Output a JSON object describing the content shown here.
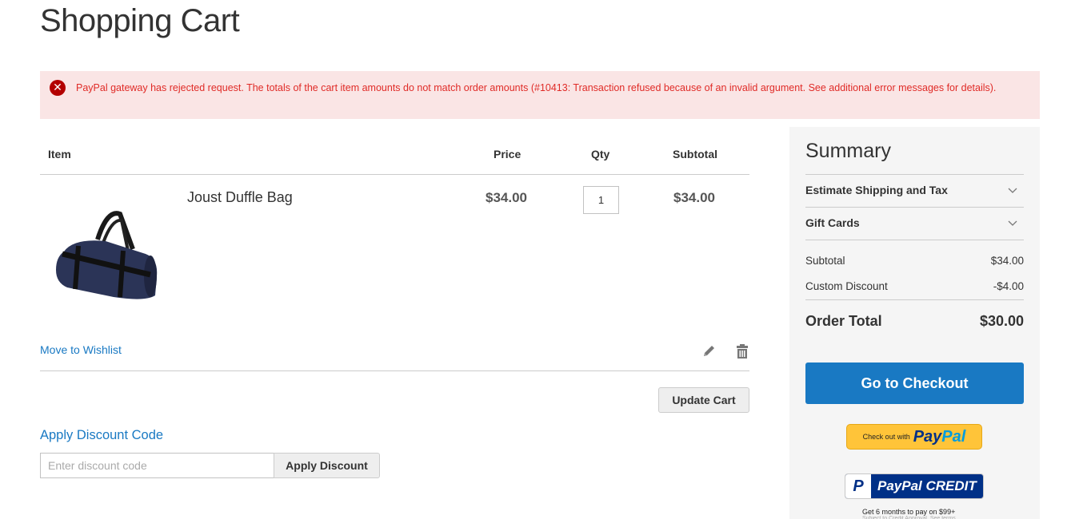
{
  "page": {
    "title": "Shopping Cart"
  },
  "error": {
    "icon": "error-x-icon",
    "message": "PayPal gateway has rejected request. The totals of the cart item amounts do not match order amounts (#10413: Transaction refused because of an invalid argument. See additional error messages for details)."
  },
  "cart": {
    "headers": {
      "item": "Item",
      "price": "Price",
      "qty": "Qty",
      "subtotal": "Subtotal"
    },
    "items": [
      {
        "name": "Joust Duffle Bag",
        "price": "$34.00",
        "qty": "1",
        "subtotal": "$34.00",
        "image": "navy duffle bag"
      }
    ],
    "move_to_wishlist": "Move to Wishlist",
    "edit_icon": "pencil-icon",
    "delete_icon": "trash-icon",
    "update_cart": "Update Cart"
  },
  "discount": {
    "title": "Apply Discount Code",
    "placeholder": "Enter discount code",
    "value": "",
    "apply_label": "Apply Discount"
  },
  "summary": {
    "title": "Summary",
    "sections": [
      {
        "label": "Estimate Shipping and Tax",
        "icon": "chevron-down-icon"
      },
      {
        "label": "Gift Cards",
        "icon": "chevron-down-icon"
      }
    ],
    "rows": [
      {
        "label": "Subtotal",
        "value": "$34.00"
      },
      {
        "label": "Custom Discount",
        "value": "-$4.00"
      }
    ],
    "order_total": {
      "label": "Order Total",
      "value": "$30.00"
    },
    "checkout_label": "Go to Checkout",
    "paypal": {
      "prefix": "Check out with",
      "pay": "Pay",
      "pal": "Pal"
    },
    "paypal_credit": {
      "label": "PayPal CREDIT",
      "note": "Get 6 months to pay on $99+",
      "subnote": "Subject to Credit Approval. See terms"
    }
  },
  "colors": {
    "accent": "#1979c3",
    "error_bg": "#fae5e5",
    "error_text": "#e02b27",
    "paypal_gold": "#ffc439",
    "paypal_navy": "#003087"
  }
}
